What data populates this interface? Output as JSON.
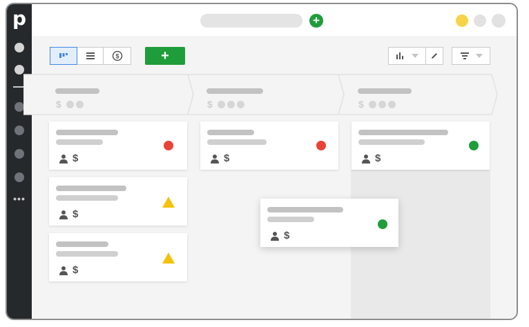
{
  "app": {
    "logo_letter": "p",
    "brand_color": "#26292c",
    "accent_green": "#1f9d3a"
  },
  "topbar": {
    "add_button_label": "+",
    "window_dot_colors": [
      "#f5d547",
      "#e2e2e2",
      "#e2e2e2"
    ]
  },
  "toolbar": {
    "views": [
      {
        "icon": "pipeline-icon",
        "active": true
      },
      {
        "icon": "list-icon",
        "active": false
      },
      {
        "icon": "forecast-icon",
        "active": false
      }
    ],
    "add_deal_label": "+"
  },
  "rail": {
    "more_label": "•••"
  },
  "stages": [
    {
      "currency": "$",
      "dots": 2
    },
    {
      "currency": "$",
      "dots": 3
    },
    {
      "currency": "$",
      "dots": 3
    }
  ],
  "cards": [
    {
      "column": 1,
      "status": "red",
      "person_icon": "person-icon",
      "currency": "$"
    },
    {
      "column": 1,
      "status": "warning",
      "person_icon": "person-icon",
      "currency": "$"
    },
    {
      "column": 1,
      "status": "warning",
      "person_icon": "person-icon",
      "currency": "$"
    },
    {
      "column": 2,
      "status": "red",
      "person_icon": "person-icon",
      "currency": "$"
    },
    {
      "column": 3,
      "status": "green",
      "person_icon": "person-icon",
      "currency": "$"
    },
    {
      "column": "dragging",
      "status": "green",
      "person_icon": "person-icon",
      "currency": "$"
    }
  ],
  "status_colors": {
    "red": "#e94335",
    "green": "#1f9d3a",
    "warning": "#f4c20d"
  }
}
